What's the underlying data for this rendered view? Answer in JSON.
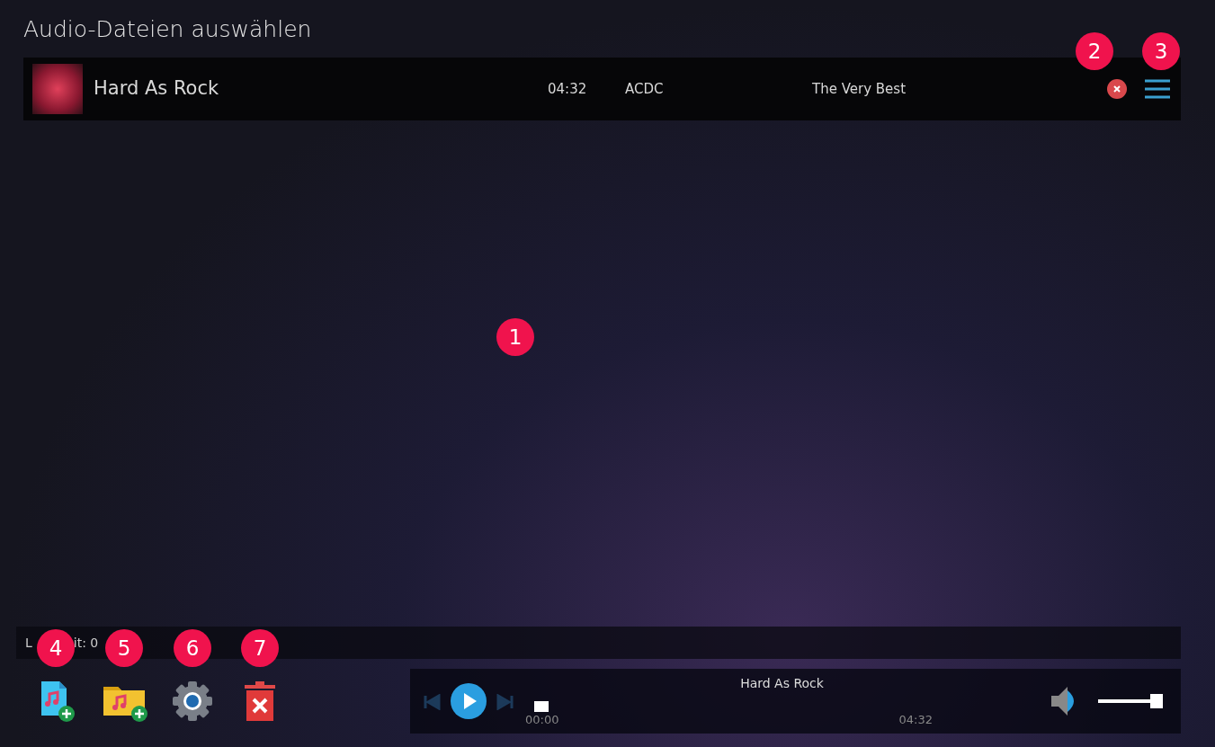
{
  "window": {
    "title": "Audio-Dateien auswählen"
  },
  "tracks": [
    {
      "title": "Hard As Rock",
      "duration": "04:32",
      "artist": "ACDC",
      "album": "The Very Best"
    }
  ],
  "status_bar": {
    "texts": [
      "L",
      "it: 0"
    ]
  },
  "toolbar": [
    {
      "kind": "add-file"
    },
    {
      "kind": "add-folder"
    },
    {
      "kind": "settings"
    },
    {
      "kind": "clear"
    }
  ],
  "player": {
    "title": "Hard As Rock",
    "position": "00:00",
    "length": "04:32",
    "progress": {
      "level": 0
    },
    "volume": {
      "level": 1
    }
  },
  "callouts": [
    {
      "number": "1",
      "kind": "list"
    },
    {
      "number": "2",
      "kind": "remove"
    },
    {
      "number": "3",
      "kind": "menu"
    },
    {
      "number": "4",
      "kind": "tool0"
    },
    {
      "number": "5",
      "kind": "tool1"
    },
    {
      "number": "6",
      "kind": "tool2"
    },
    {
      "number": "7",
      "kind": "tool3"
    }
  ]
}
